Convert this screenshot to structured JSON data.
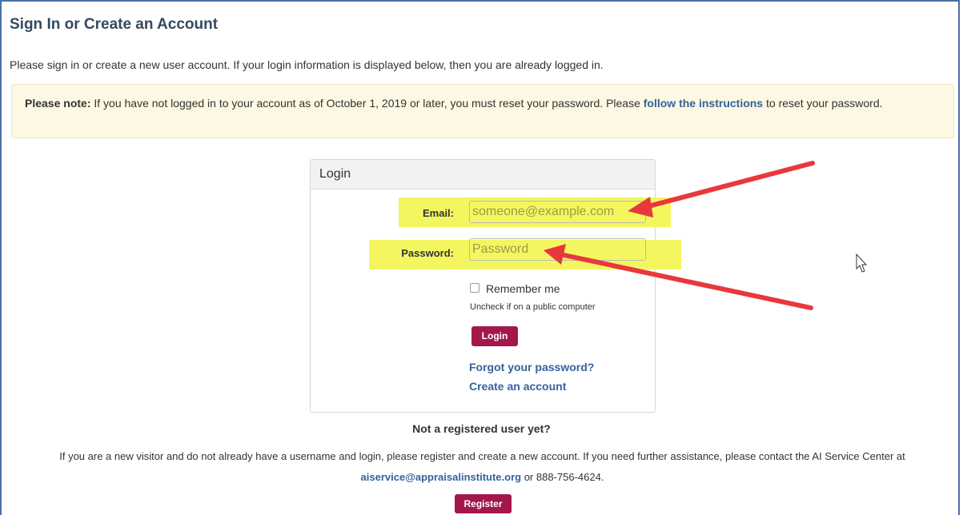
{
  "header": {
    "title": "Sign In or Create an Account",
    "intro": "Please sign in or create a new user account. If your login information is displayed below, then you are already logged in."
  },
  "notice": {
    "prefix": "Please note:",
    "text_before": " If you have not logged in to your account as of October 1, 2019 or later, you must reset your password. Please ",
    "link": "follow the instructions",
    "text_after": " to reset your password."
  },
  "login_panel": {
    "heading": "Login",
    "email_label": "Email:",
    "email_placeholder": "someone@example.com",
    "password_label": "Password:",
    "password_placeholder": "Password",
    "remember_label": "Remember me",
    "remember_hint": "Uncheck if on a public computer",
    "login_button": "Login",
    "forgot_link": "Forgot your password?",
    "create_link": "Create an account"
  },
  "register": {
    "heading": "Not a registered user yet?",
    "text_before": "If you are a new visitor and do not already have a username and login, please register and create a new account. If you need further assistance, please contact the AI Service Center at ",
    "email": "aiservice@appraisalinstitute.org",
    "text_after": " or 888-756-4624.",
    "button": "Register"
  },
  "colors": {
    "accent_button": "#a3174b",
    "link": "#34629e",
    "highlight": "#f4f660",
    "annotation_arrow": "#e8383d",
    "notice_bg": "#fcf8e3"
  },
  "icons": [
    "checkbox-icon",
    "mouse-cursor-icon",
    "annotation-arrow-icon"
  ]
}
